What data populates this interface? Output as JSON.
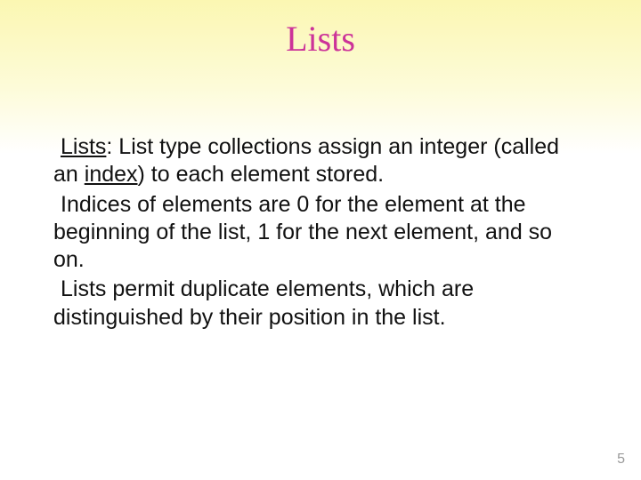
{
  "title": "Lists",
  "body": {
    "p1_prefix": "Lists",
    "p1_mid1": ": List type collections assign an integer (called an ",
    "p1_index": "index",
    "p1_tail": ") to each element stored.",
    "p2": "Indices of elements are 0 for the element at the beginning of the list, 1 for the next element, and so on.",
    "p3": "Lists permit duplicate elements, which are distinguished by their position in the list."
  },
  "page_number": "5"
}
